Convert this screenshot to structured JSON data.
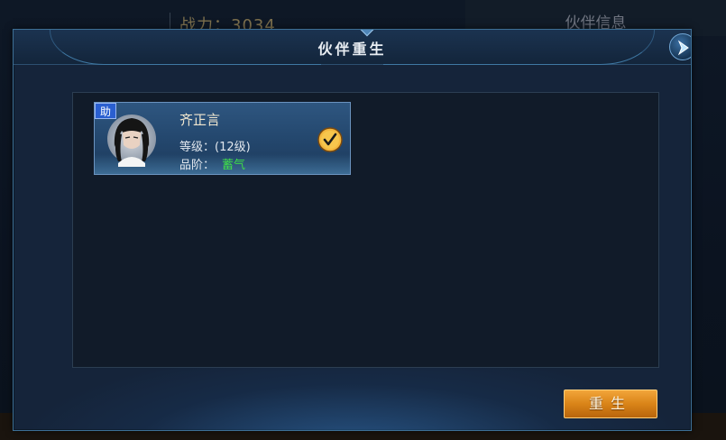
{
  "background": {
    "power_text": "战力：3034",
    "panel_title": "伙伴信息"
  },
  "dialog": {
    "title": "伙伴重生",
    "close_icon": "chevron-right-icon"
  },
  "partner": {
    "badge": "助",
    "name": "齐正言",
    "level_label": "等级：",
    "level_value": "(12级)",
    "grade_label": "品阶：",
    "grade_value": "蓄气",
    "grade_color": "#3fdc4a",
    "selected": true
  },
  "actions": {
    "rebirth_label": "重生"
  },
  "colors": {
    "accent_orange": "#d98418",
    "card_blue": "#2e5680",
    "dialog_border": "#3d6f95"
  }
}
